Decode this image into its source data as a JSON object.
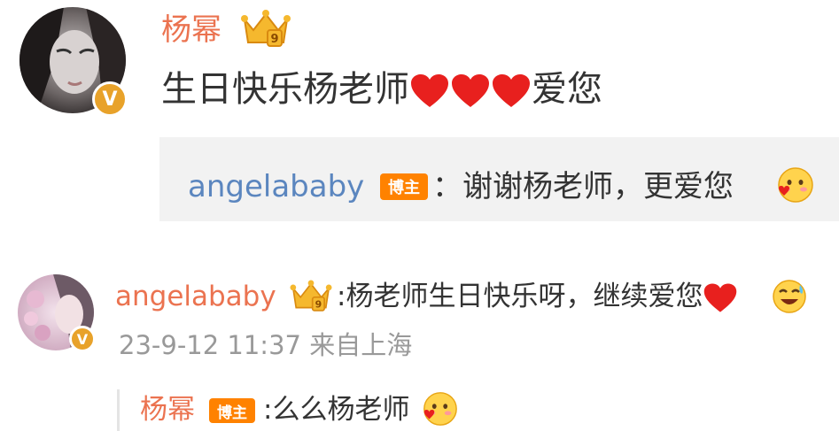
{
  "post": {
    "author": "杨幂",
    "text": "生日快乐杨老师",
    "text_tail": "爱您",
    "hearts": 3,
    "verified_icon": "verified-v-icon",
    "crown_icon": "crown-icon"
  },
  "post_reply": {
    "author": "angelababy",
    "tag": "博主",
    "text": "：谢谢杨老师，更爱您",
    "emoji": "blush-kiss-emoji"
  },
  "comment": {
    "author": "angelababy",
    "text": ":杨老师生日快乐呀，继续爱您",
    "meta": "23-9-12 11:37 来自上海",
    "emoji": "happy-tears-emoji"
  },
  "comment_reply": {
    "author": "杨幂",
    "tag": "博主",
    "text": ":么么杨老师",
    "emoji": "blush-kiss-emoji"
  },
  "colors": {
    "name_orange": "#eb7350",
    "name_blue": "#5b86bf",
    "text": "#333333",
    "meta": "#999999",
    "tag": "#ff8200",
    "heart": "#e8201e",
    "badge": "#e8a22a"
  }
}
